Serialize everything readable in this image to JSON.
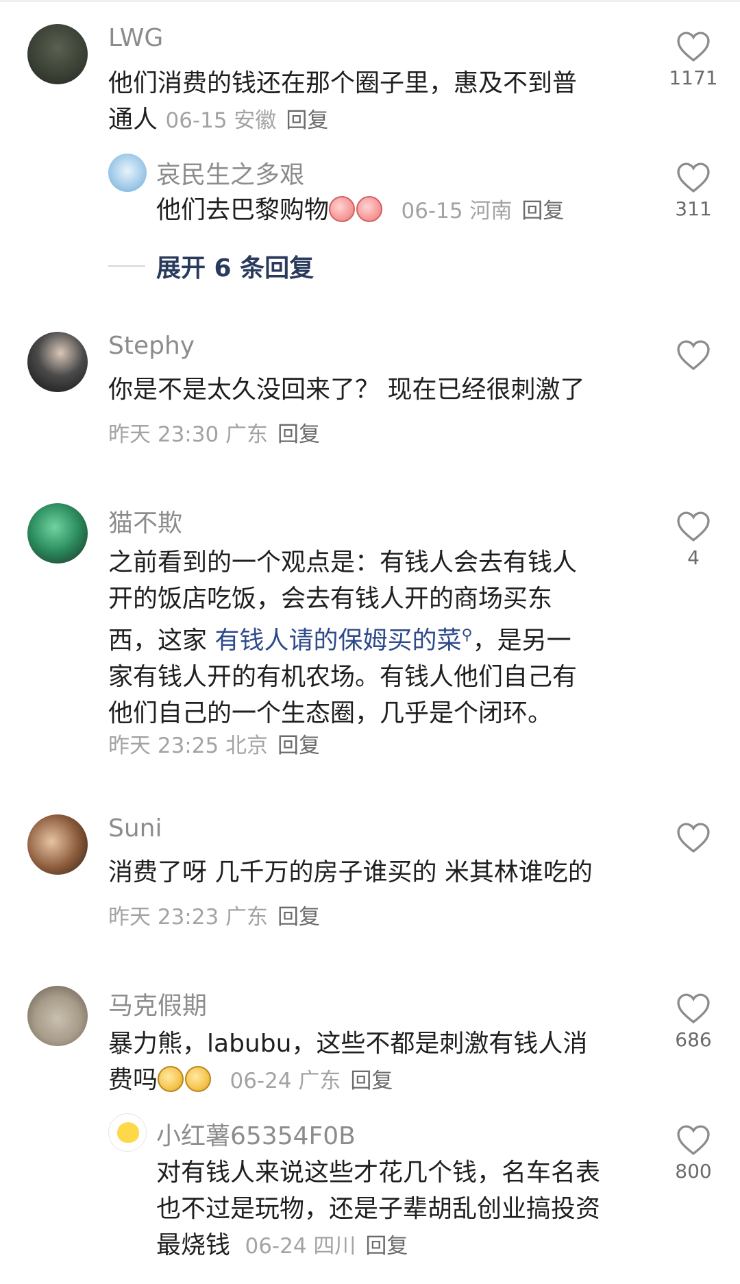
{
  "comments": [
    {
      "user": "LWG",
      "text": "他们消费的钱还在那个圈子里，惠及不到普通人",
      "text_line1": "他们消费的钱还在那个圈子里，惠及不到普",
      "text_line2": "通人",
      "meta": "06-15 安徽",
      "reply_label": "回复",
      "likes": "1171",
      "avatar_color": "#3b4236",
      "replies": [
        {
          "user": "哀民生之多艰",
          "text": "他们去巴黎购物",
          "meta": "06-15 河南",
          "reply_label": "回复",
          "likes": "311",
          "avatar_color": "#6aa7d6"
        }
      ],
      "expand_label": "展开 6 条回复"
    },
    {
      "user": "Stephy",
      "text": "你是不是太久没回来了？ 现在已经很刺激了",
      "meta": "昨天 23:30 广东",
      "reply_label": "回复",
      "likes": "",
      "avatar_color": "#1c1c1c"
    },
    {
      "user": "猫不欺",
      "text_lines": [
        "之前看到的一个观点是：有钱人会去有钱人",
        "开的饭店吃饭，会去有钱人开的商场买东",
        "西，这家 ",
        "，是另一",
        "家有钱人开的有机农场。有钱人他们自己有",
        "他们自己的一个生态圈，几乎是个闭环。"
      ],
      "link_text": "有钱人请的保姆买的菜",
      "link_icon": "⚲",
      "meta": "昨天 23:25 北京",
      "reply_label": "回复",
      "likes": "4",
      "avatar_color": "#2a8a5c"
    },
    {
      "user": "Suni",
      "text": "消费了呀 几千万的房子谁买的 米其林谁吃的",
      "meta": "昨天 23:23 广东",
      "reply_label": "回复",
      "likes": "",
      "avatar_color": "#8a5a3a"
    },
    {
      "user": "马克假期",
      "text_line1": "暴力熊，labubu，这些不都是刺激有钱人消",
      "text_line2": "费吗",
      "meta": "06-24 广东",
      "reply_label": "回复",
      "likes": "686",
      "avatar_color": "#a89c8a",
      "replies": [
        {
          "user": "小红薯65354F0B",
          "text_line1": "对有钱人来说这些才花几个钱，名车名表",
          "text_line2": "也不过是玩物，还是子辈胡乱创业搞投资",
          "text_line3": "最烧钱",
          "meta": "06-24 四川",
          "reply_label": "回复",
          "likes": "800",
          "avatar_color": "#ffffff"
        }
      ]
    }
  ],
  "icons": {
    "like": "heart-outline-icon"
  }
}
